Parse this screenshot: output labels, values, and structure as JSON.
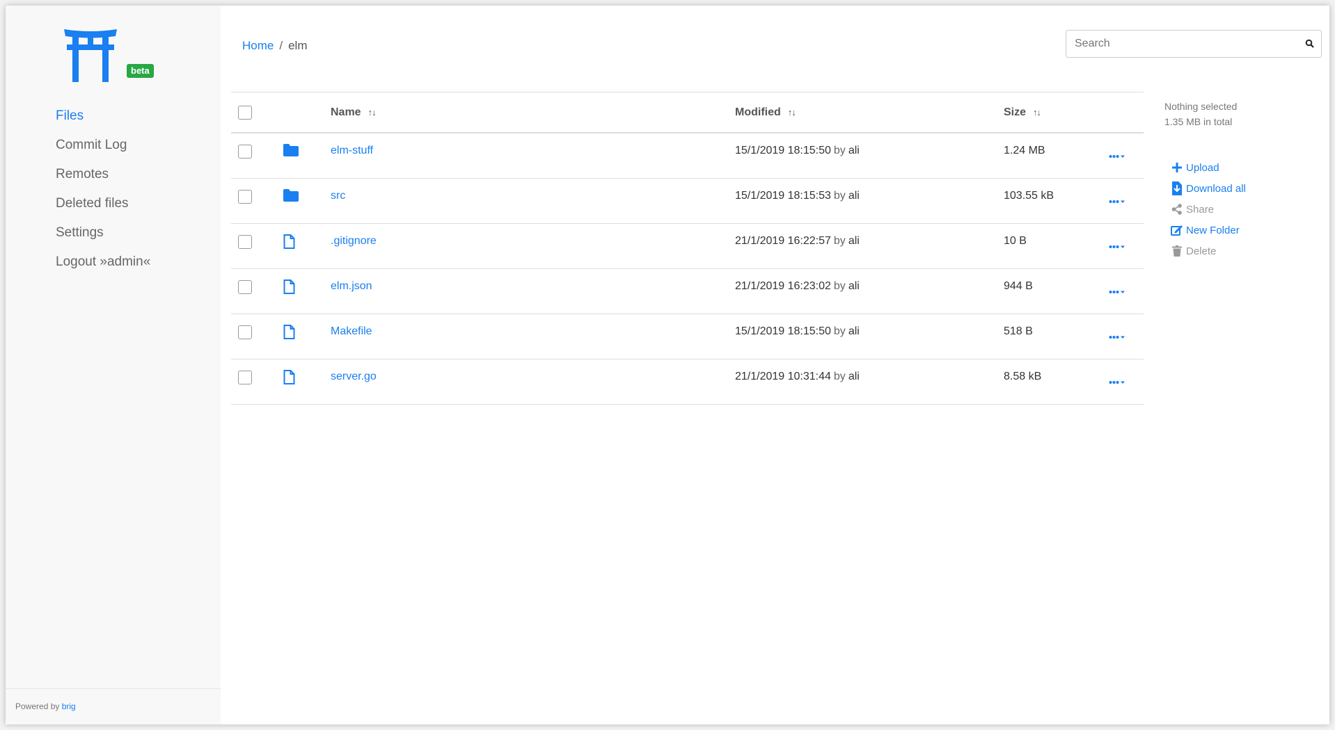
{
  "sidebar": {
    "badge": "beta",
    "items": [
      {
        "label": "Files",
        "active": true
      },
      {
        "label": "Commit Log",
        "active": false
      },
      {
        "label": "Remotes",
        "active": false
      },
      {
        "label": "Deleted files",
        "active": false
      },
      {
        "label": "Settings",
        "active": false
      },
      {
        "label": "Logout »admin«",
        "active": false
      }
    ],
    "footer": {
      "prefix": "Powered by",
      "link": "brig"
    }
  },
  "breadcrumb": {
    "home": "Home",
    "separator": "/",
    "current": "elm"
  },
  "search": {
    "placeholder": "Search",
    "value": ""
  },
  "table": {
    "headers": {
      "name": "Name",
      "modified": "Modified",
      "size": "Size",
      "sort_glyph": "↑↓"
    },
    "rows": [
      {
        "type": "folder",
        "name": "elm-stuff",
        "modified": "15/1/2019 18:15:50",
        "by": "by",
        "user": "ali",
        "size": "1.24 MB"
      },
      {
        "type": "folder",
        "name": "src",
        "modified": "15/1/2019 18:15:53",
        "by": "by",
        "user": "ali",
        "size": "103.55 kB"
      },
      {
        "type": "file",
        "name": ".gitignore",
        "modified": "21/1/2019 16:22:57",
        "by": "by",
        "user": "ali",
        "size": "10 B"
      },
      {
        "type": "file",
        "name": "elm.json",
        "modified": "21/1/2019 16:23:02",
        "by": "by",
        "user": "ali",
        "size": "944 B"
      },
      {
        "type": "file",
        "name": "Makefile",
        "modified": "15/1/2019 18:15:50",
        "by": "by",
        "user": "ali",
        "size": "518 B"
      },
      {
        "type": "file",
        "name": "server.go",
        "modified": "21/1/2019 10:31:44",
        "by": "by",
        "user": "ali",
        "size": "8.58 kB"
      }
    ]
  },
  "info": {
    "selection": "Nothing selected",
    "total": "1.35 MB in total"
  },
  "actions": [
    {
      "label": "Upload",
      "icon": "plus-icon",
      "enabled": true
    },
    {
      "label": "Download all",
      "icon": "download-icon",
      "enabled": true
    },
    {
      "label": "Share",
      "icon": "share-icon",
      "enabled": false
    },
    {
      "label": "New Folder",
      "icon": "edit-icon",
      "enabled": true
    },
    {
      "label": "Delete",
      "icon": "trash-icon",
      "enabled": false
    }
  ],
  "colors": {
    "accent": "#1a7ff0",
    "badge": "#28a745",
    "muted": "#999999"
  }
}
